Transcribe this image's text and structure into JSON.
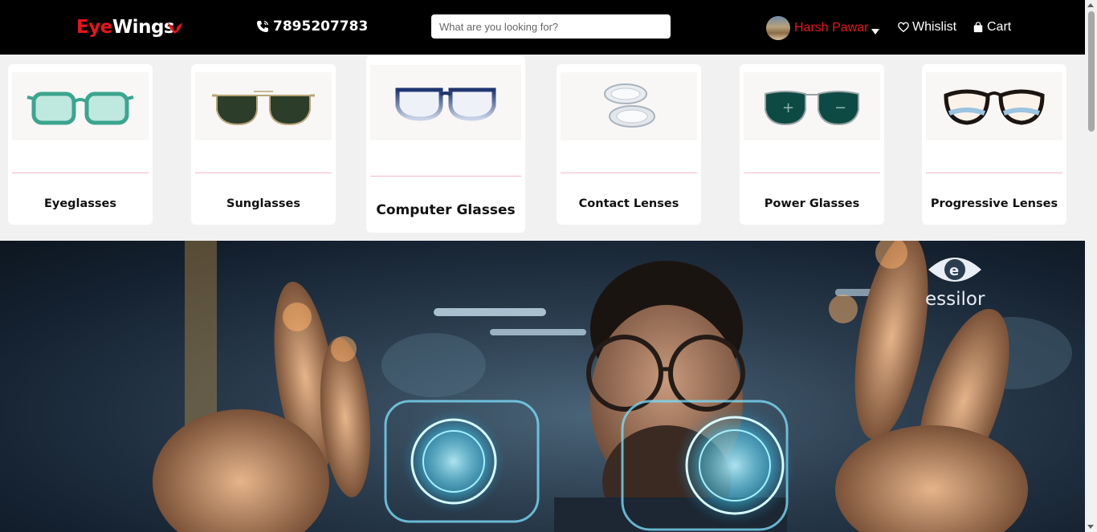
{
  "header": {
    "logo_part1": "Eye",
    "logo_part2": "Wings",
    "phone": "7895207783",
    "search_placeholder": "What are you looking for?",
    "user_name": "Harsh Pawar",
    "wishlist_label": "Whislist",
    "cart_label": "Cart",
    "colors": {
      "background": "#000000",
      "accent": "#e8151b"
    }
  },
  "categories": [
    {
      "label": "Eyeglasses",
      "icon": "green-eyeglasses-thumbnail"
    },
    {
      "label": "Sunglasses",
      "icon": "aviator-sunglasses-thumbnail"
    },
    {
      "label": "Computer Glasses",
      "icon": "blue-computer-glasses-thumbnail"
    },
    {
      "label": "Contact Lenses",
      "icon": "contact-lenses-thumbnail"
    },
    {
      "label": "Power Glasses",
      "icon": "power-glasses-thumbnail"
    },
    {
      "label": "Progressive Lenses",
      "icon": "progressive-glasses-thumbnail"
    }
  ],
  "banner": {
    "brand": "essilor",
    "icon": "essilor-logo-icon"
  }
}
